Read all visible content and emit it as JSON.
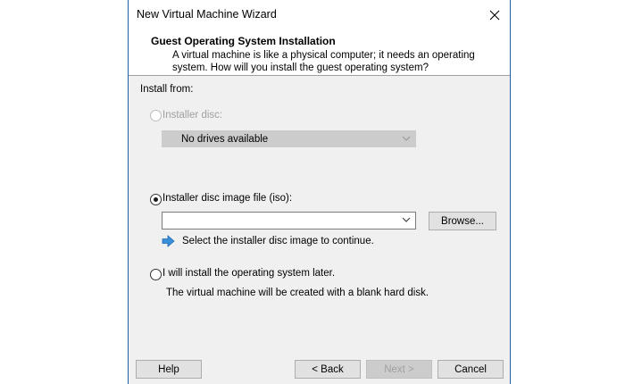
{
  "window": {
    "title": "New Virtual Machine Wizard",
    "close_label": "✕"
  },
  "header": {
    "title": "Guest Operating System Installation",
    "description": "A virtual machine is like a physical computer; it needs an operating system. How will you install the guest operating system?"
  },
  "install_from": {
    "label": "Install from:",
    "disc_option": {
      "label": "Installer disc:",
      "selected": false,
      "enabled": false,
      "dropdown_value": "No drives available"
    },
    "iso_option": {
      "label": "Installer disc image file (iso):",
      "selected": true,
      "enabled": true,
      "path_value": "",
      "browse_label": "Browse...",
      "hint": "Select the installer disc image to continue."
    },
    "later_option": {
      "label": "I will install the operating system later.",
      "selected": false,
      "enabled": true,
      "note": "The virtual machine will be created with a blank hard disk."
    }
  },
  "footer": {
    "help_label": "Help",
    "back_label": "< Back",
    "next_label": "Next >",
    "cancel_label": "Cancel"
  },
  "colors": {
    "accent_border": "#1f5fa8",
    "info_arrow": "#3a8fd9"
  },
  "icons": {
    "close": "close-icon",
    "dropdown": "chevron-down-icon",
    "hint": "info-arrow-icon"
  }
}
